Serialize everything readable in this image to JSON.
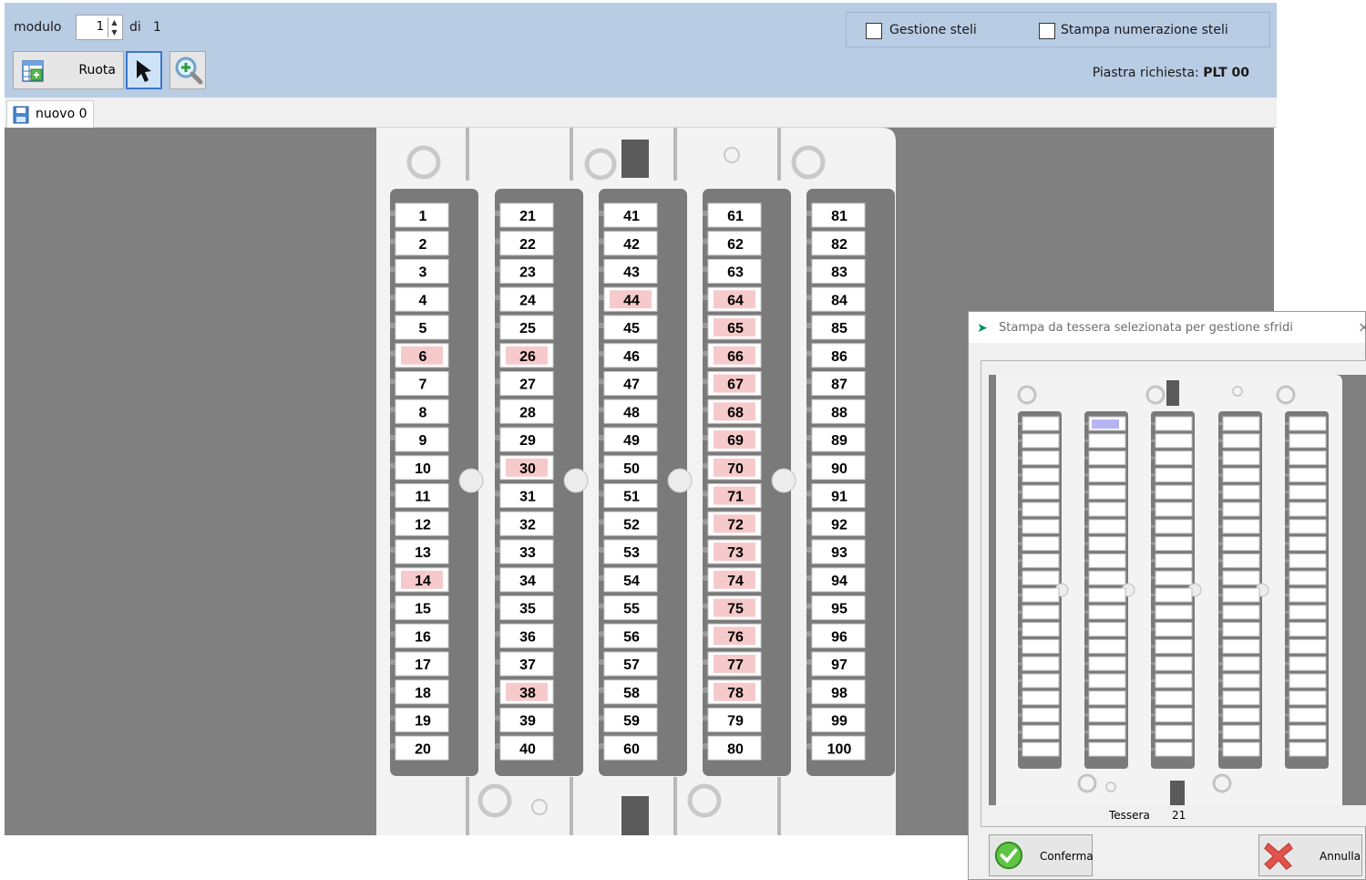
{
  "toolbar": {
    "modulo_label": "modulo",
    "modulo_value": "1",
    "di_label": "di",
    "di_value": "1",
    "ruota_label": "Ruota",
    "gestione_steli": "Gestione steli",
    "stampa_numerazione_steli": "Stampa numerazione steli",
    "piastra_label": "Piastra richiesta:",
    "piastra_value": "PLT 00"
  },
  "tabs": [
    {
      "label": "nuovo 0"
    }
  ],
  "plate": {
    "columns": [
      {
        "numbers": [
          "1",
          "2",
          "3",
          "4",
          "5",
          "6",
          "7",
          "8",
          "9",
          "10",
          "11",
          "12",
          "13",
          "14",
          "15",
          "16",
          "17",
          "18",
          "19",
          "20"
        ]
      },
      {
        "numbers": [
          "21",
          "22",
          "23",
          "24",
          "25",
          "26",
          "27",
          "28",
          "29",
          "30",
          "31",
          "32",
          "33",
          "34",
          "35",
          "36",
          "37",
          "38",
          "39",
          "40"
        ]
      },
      {
        "numbers": [
          "41",
          "42",
          "43",
          "44",
          "45",
          "46",
          "47",
          "48",
          "49",
          "50",
          "51",
          "52",
          "53",
          "54",
          "55",
          "56",
          "57",
          "58",
          "59",
          "60"
        ]
      },
      {
        "numbers": [
          "61",
          "62",
          "63",
          "64",
          "65",
          "66",
          "67",
          "68",
          "69",
          "70",
          "71",
          "72",
          "73",
          "74",
          "75",
          "76",
          "77",
          "78",
          "79",
          "80"
        ]
      },
      {
        "numbers": [
          "81",
          "82",
          "83",
          "84",
          "85",
          "86",
          "87",
          "88",
          "89",
          "90",
          "91",
          "92",
          "93",
          "94",
          "95",
          "96",
          "97",
          "98",
          "99",
          "100"
        ]
      }
    ],
    "highlighted": [
      6,
      14,
      26,
      30,
      38,
      44,
      64,
      65,
      66,
      67,
      68,
      69,
      70,
      71,
      72,
      73,
      74,
      75,
      76,
      77,
      78
    ]
  },
  "dialog": {
    "title": "Stampa da tessera selezionata per gestione sfridi",
    "close": "×",
    "tessera_label": "Tessera",
    "tessera_value": "21",
    "confirm_label": "Conferma",
    "cancel_label": "Annulla"
  },
  "colors": {
    "toolbar_bg": "#b8cce4",
    "canvas_bg": "#808080",
    "plate": "#f3f3f3",
    "slot": "#7a7a7a",
    "highlight": "#f6caca",
    "selected_tile": "#b6b4f3"
  }
}
